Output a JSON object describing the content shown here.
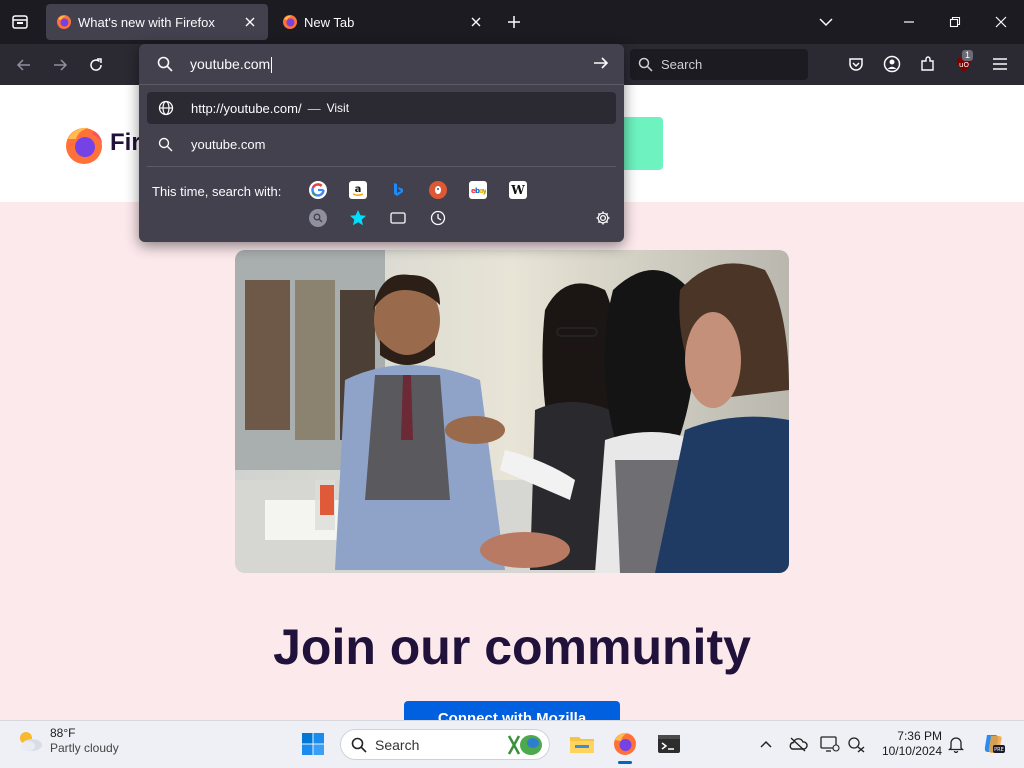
{
  "tabs": [
    {
      "title": "What's new with Firefox",
      "active": true
    },
    {
      "title": "New Tab",
      "active": false
    }
  ],
  "urlbar": {
    "value": "youtube.com",
    "results": [
      {
        "icon": "globe-icon",
        "text": "http://youtube.com/",
        "separator": "—",
        "action": "Visit"
      },
      {
        "icon": "search-icon",
        "text": "youtube.com"
      }
    ],
    "oneoff_label": "This time, search with:",
    "engines": [
      "google-icon",
      "amazon-icon",
      "bing-icon",
      "duckduckgo-icon",
      "ebay-icon",
      "wikipedia-icon",
      "search-engine-icon",
      "bookmarks-icon",
      "tabs-icon",
      "history-icon"
    ]
  },
  "searchbar": {
    "placeholder": "Search"
  },
  "toolbar": {
    "extension_badge": "1"
  },
  "page": {
    "brand_text": "Firefox",
    "heading": "Join our community",
    "cta": "Connect with Mozilla"
  },
  "taskbar": {
    "weather_temp": "88°F",
    "weather_condition": "Partly cloudy",
    "search_label": "Search",
    "time": "7:36 PM",
    "date": "10/10/2024"
  },
  "colors": {
    "tabstrip": "#1c1b22",
    "navbar": "#2b2a33",
    "panel": "#42414d",
    "page_bg": "#fce9ec",
    "heading": "#20123a",
    "cta": "#0060df"
  }
}
